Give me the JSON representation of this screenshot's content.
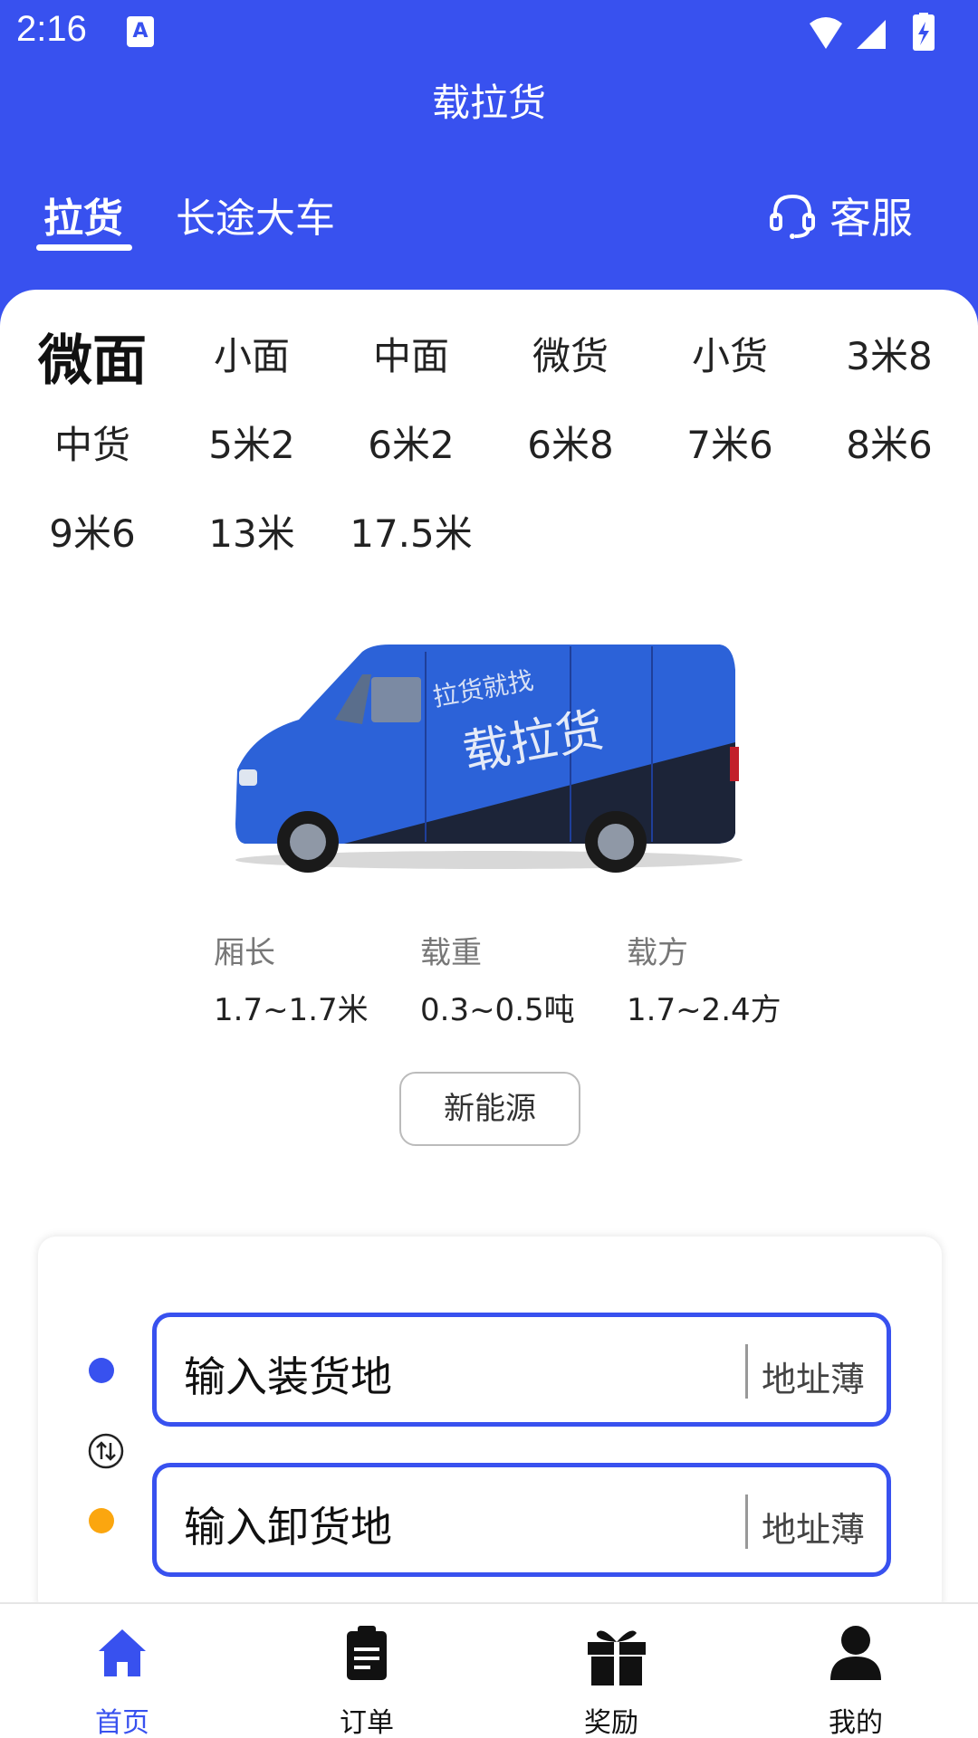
{
  "status_bar": {
    "time": "2:16",
    "notification_icon": "A"
  },
  "app": {
    "title": "载拉货"
  },
  "top_tabs": [
    {
      "label": "拉货",
      "active": true
    },
    {
      "label": "长途大车",
      "active": false
    }
  ],
  "service": {
    "label": "客服"
  },
  "vehicle_types": [
    "微面",
    "小面",
    "中面",
    "微货",
    "小货",
    "3米8",
    "中货",
    "5米2",
    "6米2",
    "6米8",
    "7米6",
    "8米6",
    "9米6",
    "13米",
    "17.5米"
  ],
  "selected_vehicle": "微面",
  "van_image": {
    "tagline": "拉货就找",
    "brand": "载拉货"
  },
  "specs": [
    {
      "label": "厢长",
      "value": "1.7~1.7米"
    },
    {
      "label": "载重",
      "value": "0.3~0.5吨"
    },
    {
      "label": "载方",
      "value": "1.7~2.4方"
    }
  ],
  "energy_button": "新能源",
  "address": {
    "load_placeholder": "输入装货地",
    "unload_placeholder": "输入卸货地",
    "book_label": "地址薄"
  },
  "colors": {
    "primary": "#3851ef",
    "orange": "#fba60f"
  },
  "bottom_tabs": [
    {
      "label": "首页",
      "icon": "home-icon",
      "active": true
    },
    {
      "label": "订单",
      "icon": "clipboard-icon",
      "active": false
    },
    {
      "label": "奖励",
      "icon": "gift-icon",
      "active": false
    },
    {
      "label": "我的",
      "icon": "user-icon",
      "active": false
    }
  ]
}
